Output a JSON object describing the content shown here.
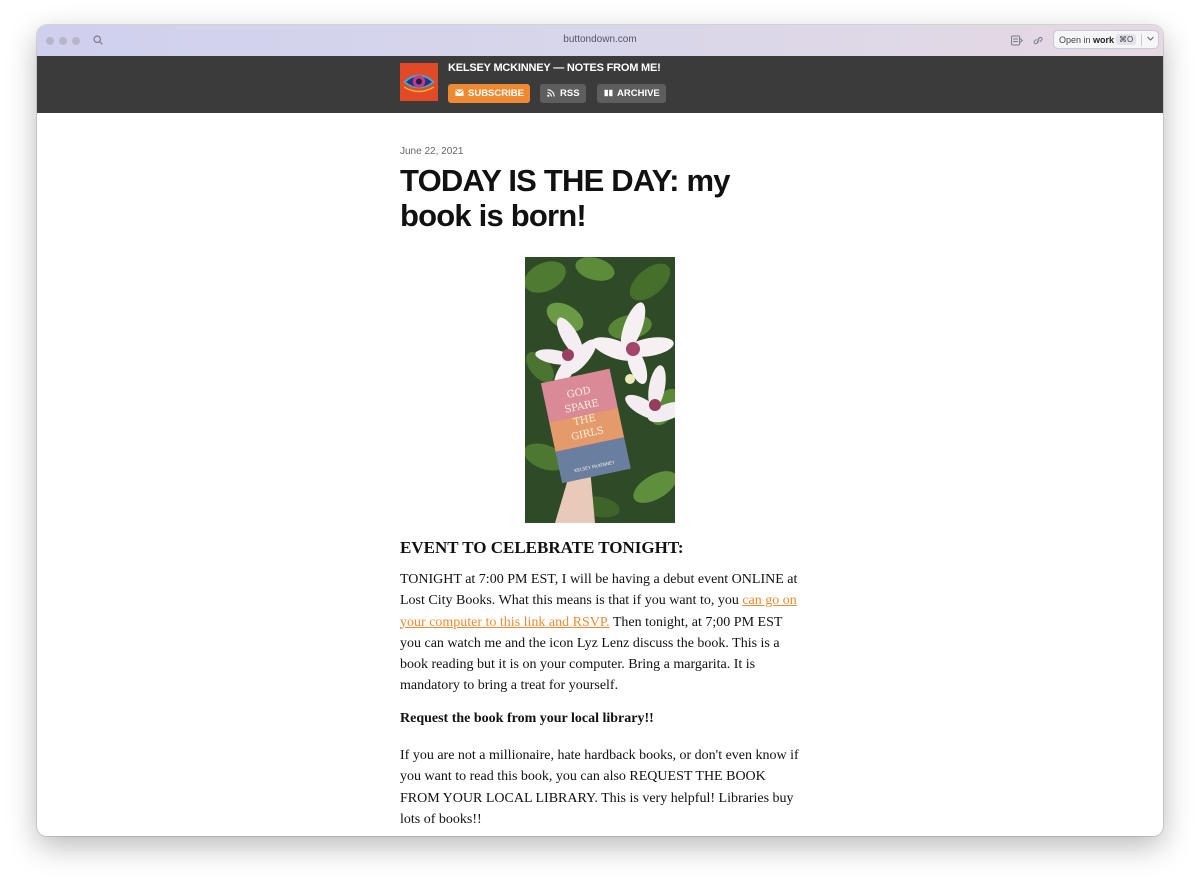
{
  "browser": {
    "url": "buttondown.com",
    "open_in_label": "Open in",
    "open_in_target": "work",
    "open_in_shortcut": "⌘O"
  },
  "site": {
    "title": "KELSEY MCKINNEY — NOTES FROM ME!",
    "nav": {
      "subscribe": "SUBSCRIBE",
      "rss": "RSS",
      "archive": "ARCHIVE"
    },
    "accent_color": "#ef8a32",
    "header_color": "#3b3b3b"
  },
  "post": {
    "date": "June 22, 2021",
    "title": "TODAY IS THE DAY: my book is born!",
    "image": {
      "book_title": "GOD SPARE THE GIRLS",
      "book_author": "KELSEY McKINNEY"
    },
    "event_heading": "EVENT TO CELEBRATE TONIGHT:",
    "event_paragraph": {
      "before_link": "TONIGHT at 7:00 PM EST, I will be having a debut event ONLINE at Lost City Books. What this means is that if you want to, you ",
      "link_text": "can go on your computer to this link and RSVP.",
      "after_link": " Then tonight, at 7;00 PM EST you can watch me and the icon Lyz Lenz discuss the book. This is a book reading but it is on your computer. Bring a margarita. It is mandatory to bring a treat for yourself."
    },
    "library_heading": "Request the book from your local library!!",
    "library_paragraph": "If you are not a millionaire, hate hardback books, or don't even know if you want to read this book, you can also REQUEST THE BOOK FROM YOUR LOCAL LIBRARY. This is very helpful! Libraries buy lots of books!!"
  }
}
